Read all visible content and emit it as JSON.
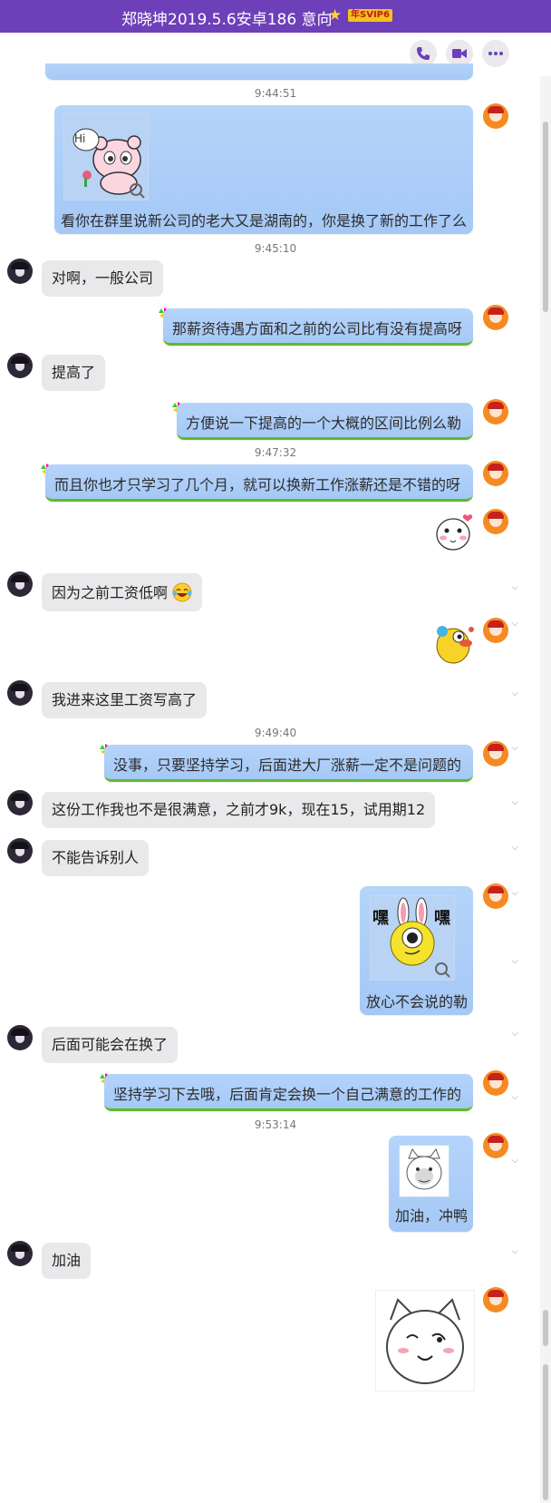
{
  "window": {
    "title": "郑晓坤2019.5.6安卓186 意向",
    "vip_badge": "年SVIP6"
  },
  "toolbar": {
    "icons": [
      "phone-icon",
      "video-call-icon",
      "more-icon"
    ]
  },
  "colors": {
    "titlebar": "#6d3fb8",
    "my_bubble": "#b5d4fa",
    "their_bubble": "#e9e9eb"
  },
  "timestamps": [
    "9:44:51",
    "9:45:10",
    "9:47:32",
    "9:49:40",
    "9:53:14"
  ],
  "messages": [
    {
      "from": "me",
      "type": "image_text",
      "text": "看你在群里说新公司的老大又是湖南的，你是换了新的工作了么",
      "sticker": "hi-bear-sticker"
    },
    {
      "from": "other",
      "text": "对啊，一般公司"
    },
    {
      "from": "me",
      "text": "那薪资待遇方面和之前的公司比有没有提高呀"
    },
    {
      "from": "other",
      "text": "提高了"
    },
    {
      "from": "me",
      "text": "方便说一下提高的一个大概的区间比例么勒"
    },
    {
      "from": "me",
      "text": "而且你也才只学习了几个月，就可以换新工作涨薪还是不错的呀"
    },
    {
      "from": "me",
      "type": "sticker",
      "sticker": "blush-heart-sticker"
    },
    {
      "from": "other",
      "text": "因为之前工资低啊",
      "emoji": "laughing-tears-emoji"
    },
    {
      "from": "me",
      "type": "sticker",
      "sticker": "yellow-duck-sticker"
    },
    {
      "from": "other",
      "text": "我进来这里工资写高了"
    },
    {
      "from": "me",
      "text": "没事，只要坚持学习，后面进大厂涨薪一定不是问题的"
    },
    {
      "from": "other",
      "text": "这份工作我也不是很满意，之前才9k，现在15，试用期12"
    },
    {
      "from": "other",
      "text": "不能告诉别人"
    },
    {
      "from": "me",
      "type": "image_text",
      "text": "放心不会说的勒",
      "sticker": "bunny-shh-sticker",
      "sticker_text": [
        "嘿",
        "嘿"
      ]
    },
    {
      "from": "other",
      "text": "后面可能会在换了"
    },
    {
      "from": "me",
      "text": "坚持学习下去哦，后面肯定会换一个自己满意的工作的"
    },
    {
      "from": "me",
      "type": "image_text",
      "text": "加油，冲鸭",
      "sticker": "cat-meme-sticker"
    },
    {
      "from": "other",
      "text": "加油"
    },
    {
      "from": "me",
      "type": "sticker",
      "sticker": "white-cat-sticker"
    }
  ]
}
